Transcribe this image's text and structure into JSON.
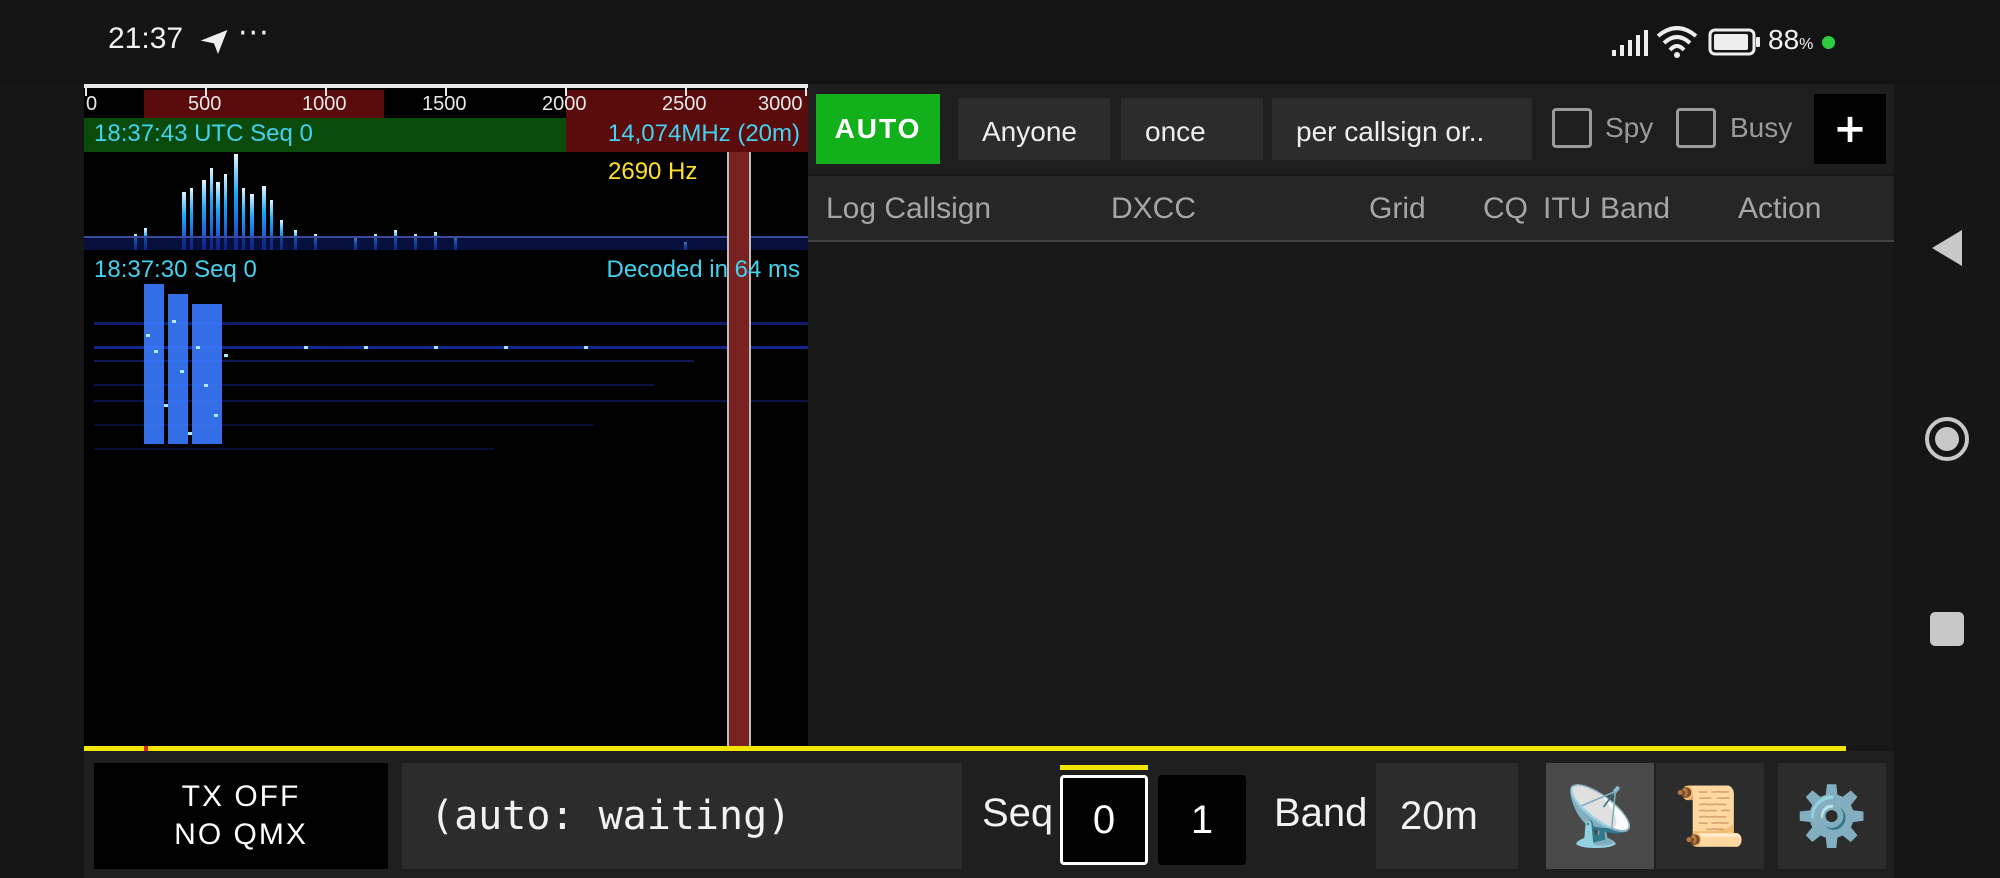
{
  "status_bar": {
    "time": "21:37",
    "more": "···",
    "battery_pct": "88",
    "battery_unit": "%",
    "icons": [
      "send-icon",
      "signal-icon",
      "wifi-icon",
      "battery-icon"
    ]
  },
  "waterfall": {
    "scale_ticks": [
      "0",
      "500",
      "1000",
      "1500",
      "2000",
      "2500",
      "3000"
    ],
    "utc_label": "18:37:43 UTC Seq 0",
    "frequency_label": "14,074MHz (20m)",
    "cursor_hz": "2690 Hz",
    "seq_label": "18:37:30 Seq 0",
    "decoded_label": "Decoded in 64 ms",
    "colors": {
      "tx_marker": "#7a2222",
      "rx_band": "#0a4a0a",
      "signal": "#1aa8ff"
    }
  },
  "toolbar": {
    "auto_label": "AUTO",
    "target": "Anyone",
    "repeat": "once",
    "mode": "per callsign or..",
    "spy_label": "Spy",
    "busy_label": "Busy",
    "add_label": "+",
    "spy_checked": false,
    "busy_checked": false
  },
  "table": {
    "columns": {
      "log_callsign": "Log Callsign",
      "dxcc": "DXCC",
      "grid": "Grid",
      "cq": "CQ",
      "itu": "ITU",
      "band": "Band",
      "action": "Action"
    },
    "rows": []
  },
  "bottom": {
    "tx_line1": "TX OFF",
    "tx_line2": "NO QMX",
    "status_text": "(auto: waiting)",
    "seq_label": "Seq",
    "seq0": "0",
    "seq1": "1",
    "band_label": "Band",
    "band_value": "20m",
    "icons": [
      "satellite-dish-icon",
      "scroll-icon",
      "gear-icon"
    ],
    "dish_glyph": "📡",
    "scroll_glyph": "📜",
    "gear_glyph": "⚙️"
  },
  "colors": {
    "accent_green": "#12b01a",
    "progress_yellow": "#f2e600",
    "cyan_text": "#43d3f0",
    "yellow_text": "#ffe02a"
  }
}
